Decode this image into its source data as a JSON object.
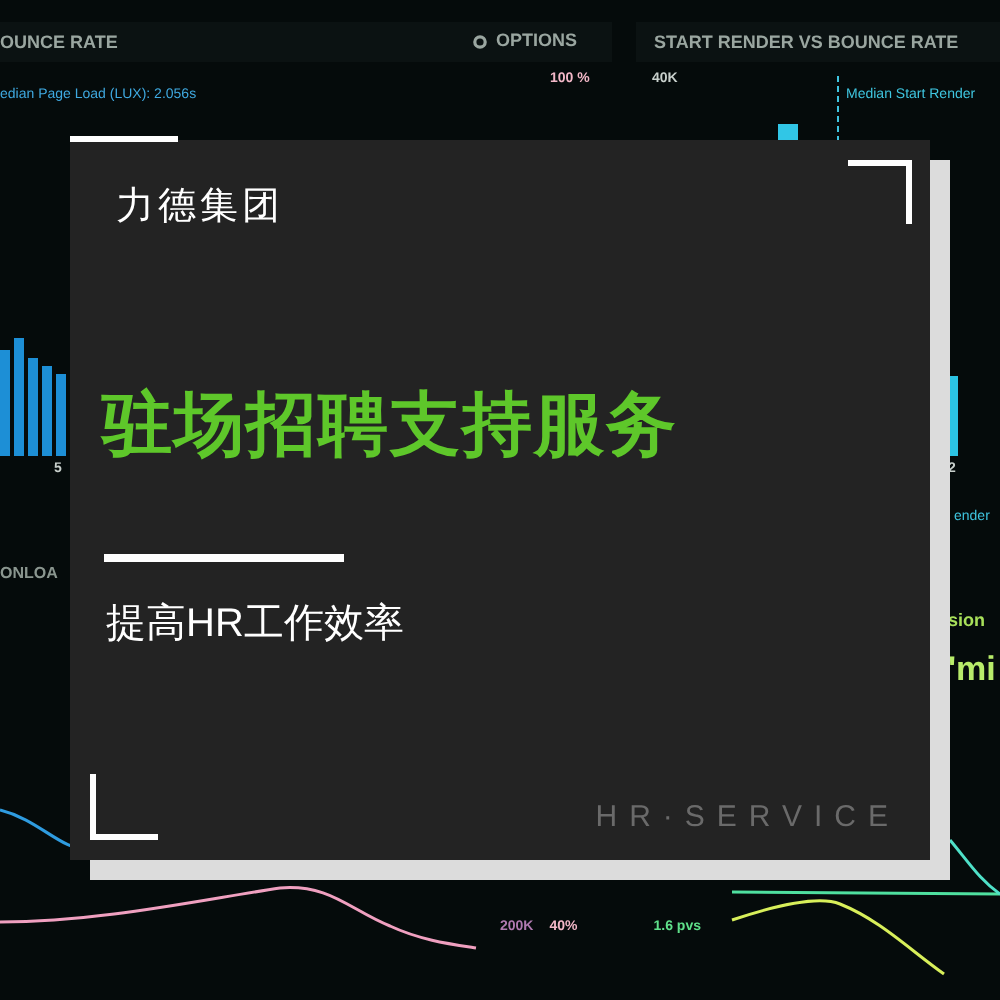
{
  "dashboard": {
    "left_panel": {
      "title": "OUNCE RATE",
      "options": "OPTIONS",
      "percent": "100 %",
      "median_label": "edian Page Load (LUX): 2.056s",
      "axis_label": "5"
    },
    "right_panel": {
      "title": "START RENDER VS BOUNCE RATE",
      "y_tick": "40K",
      "median_label": "Median Start Render",
      "median_label_2": "ender",
      "axis_label": "2"
    },
    "lower_left_panel": {
      "title": "ONLOA"
    },
    "lower_right_panel": {
      "title": "sion",
      "value": "'mi"
    },
    "footer_stats": [
      "200K",
      "40%",
      "1.6 pvs"
    ]
  },
  "card": {
    "brand": "力德集团",
    "headline": "驻场招聘支持服务",
    "subtitle": "提高HR工作效率",
    "tagline": "HR·SERVICE"
  }
}
